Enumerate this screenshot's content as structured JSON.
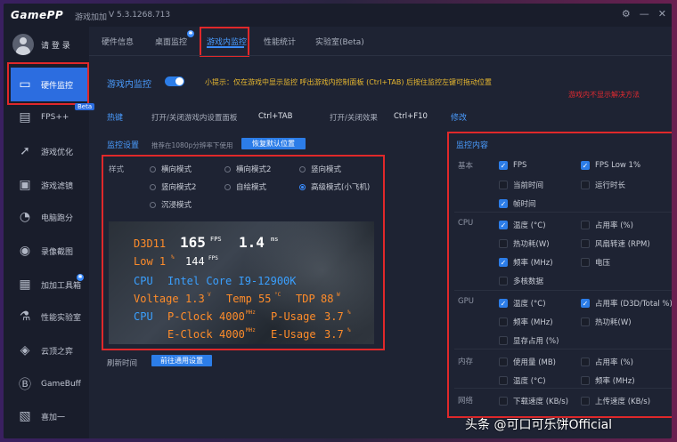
{
  "app": {
    "logo": "GamePP",
    "name": "游戏加加",
    "version": "V 5.3.1268.713",
    "window_controls": [
      "⚙",
      "—",
      "✕"
    ]
  },
  "user": {
    "login": "请 登 录"
  },
  "sidebar": {
    "items": [
      {
        "label": "硬件监控",
        "icon": "monitor-icon",
        "active": true
      },
      {
        "label": "FPS++",
        "icon": "fps-icon",
        "badge": "Beta"
      },
      {
        "label": "游戏优化",
        "icon": "rocket-icon"
      },
      {
        "label": "游戏滤镜",
        "icon": "filter-icon"
      },
      {
        "label": "电脑跑分",
        "icon": "speedometer-icon"
      },
      {
        "label": "录像截图",
        "icon": "camera-icon"
      },
      {
        "label": "加加工具箱",
        "icon": "toolbox-icon"
      },
      {
        "label": "性能实验室",
        "icon": "flask-icon"
      },
      {
        "label": "云顶之弈",
        "icon": "game-icon"
      },
      {
        "label": "GameBuff",
        "icon": "gamebuff-icon"
      },
      {
        "label": "喜加一",
        "icon": "gift-icon"
      }
    ]
  },
  "tabs": [
    "硬件信息",
    "桌面监控",
    "游戏内监控",
    "性能统计",
    "实验室(Beta)"
  ],
  "monitor": {
    "title": "游戏内监控",
    "enabled": true,
    "tip": "小提示：仅在游戏中显示监控 呼出游戏内控制面板 (Ctrl+TAB) 后按住监控左键可拖动位置",
    "not_showing_link": "游戏内不显示解决方法"
  },
  "hotkeys": {
    "label": "热键",
    "toggle_panel_label": "打开/关闭游戏内设置面板",
    "toggle_panel_key": "Ctrl+TAB",
    "toggle_effect_label": "打开/关闭效果",
    "toggle_effect_key": "Ctrl+F10",
    "edit": "修改"
  },
  "monitor_settings": {
    "label": "监控设置",
    "note": "推荐在1080p分辨率下使用",
    "reset_button": "恢复默认位置"
  },
  "style": {
    "label": "样式",
    "options": [
      "横向模式",
      "横向模式2",
      "竖向模式",
      "竖向模式2",
      "自绘模式",
      "高级模式(小飞机)",
      "沉浸模式"
    ],
    "selected": "高级模式(小飞机)"
  },
  "overlay": {
    "d3d": "D3D11",
    "fps": "165",
    "fps_unit": "FPS",
    "frametime": "1.4",
    "frametime_unit": "ms",
    "low_label": "Low 1",
    "low_unit_pct": "%",
    "low_value": "144",
    "low_unit": "FPS",
    "cpu_label": "CPU",
    "cpu_name": "Intel Core I9-12900K",
    "voltage_label": "Voltage",
    "voltage_value": "1.3",
    "voltage_unit": "V",
    "temp_label": "Temp",
    "temp_value": "55",
    "temp_unit": "°C",
    "tdp_label": "TDP",
    "tdp_value": "88",
    "tdp_unit": "W",
    "pclock_label": "P-Clock",
    "pclock_value": "4000",
    "clock_unit": "MHz",
    "pusage_label": "P-Usage",
    "pusage_value": "3.7",
    "usage_unit": "%",
    "eclock_label": "E-Clock",
    "eclock_value": "4000",
    "eusage_label": "E-Usage",
    "eusage_value": "3.7"
  },
  "refresh": {
    "label": "刷新时间",
    "button": "前往通用设置"
  },
  "content": {
    "title": "监控内容",
    "groups": [
      {
        "name": "基本",
        "items": [
          {
            "label": "FPS",
            "on": true
          },
          {
            "label": "FPS Low 1%",
            "on": true
          },
          {
            "label": "当前时间",
            "on": false
          },
          {
            "label": "运行时长",
            "on": false
          },
          {
            "label": "帧时间",
            "on": true
          }
        ]
      },
      {
        "name": "CPU",
        "items": [
          {
            "label": "温度 (°C)",
            "on": true
          },
          {
            "label": "占用率 (%)",
            "on": false
          },
          {
            "label": "热功耗(W)",
            "on": false
          },
          {
            "label": "风扇转速 (RPM)",
            "on": false
          },
          {
            "label": "频率 (MHz)",
            "on": true
          },
          {
            "label": "电压",
            "on": false
          },
          {
            "label": "多核数据",
            "on": false
          }
        ]
      },
      {
        "name": "GPU",
        "items": [
          {
            "label": "温度 (°C)",
            "on": true
          },
          {
            "label": "占用率 (D3D/Total %)",
            "on": true
          },
          {
            "label": "频率 (MHz)",
            "on": false
          },
          {
            "label": "热功耗(W)",
            "on": false
          },
          {
            "label": "显存占用 (%)",
            "on": false
          }
        ]
      },
      {
        "name": "内存",
        "items": [
          {
            "label": "使用量 (MB)",
            "on": false
          },
          {
            "label": "占用率 (%)",
            "on": false
          },
          {
            "label": "温度 (°C)",
            "on": false
          },
          {
            "label": "频率 (MHz)",
            "on": false
          }
        ]
      },
      {
        "name": "网络",
        "items": [
          {
            "label": "下载速度 (KB/s)",
            "on": false
          },
          {
            "label": "上传速度 (KB/s)",
            "on": false
          }
        ]
      }
    ]
  },
  "watermark": "头条 @可口可乐饼Official",
  "colors": {
    "accent": "#2c7de8",
    "highlight_box": "#e0282a",
    "tip": "#e8b830",
    "overlay_cyan": "#3aa0ff",
    "overlay_orange": "#ff8c2a"
  }
}
